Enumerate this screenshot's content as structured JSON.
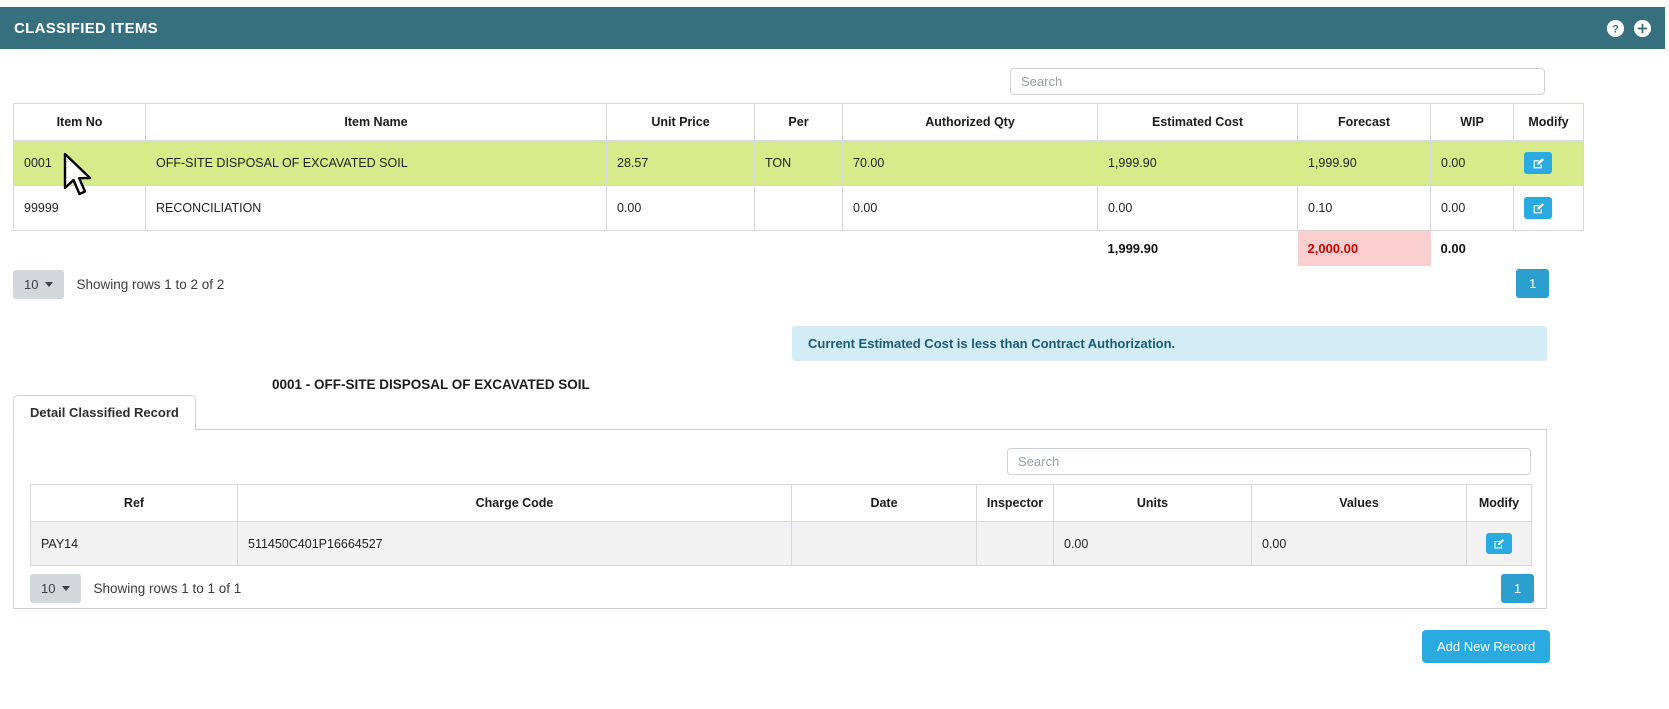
{
  "header": {
    "title": "CLASSIFIED ITEMS",
    "help_icon": "help-circle-icon",
    "add_icon": "plus-circle-icon"
  },
  "main_search": {
    "placeholder": "Search",
    "value": ""
  },
  "main_table": {
    "columns": [
      "Item No",
      "Item Name",
      "Unit Price",
      "Per",
      "Authorized Qty",
      "Estimated Cost",
      "Forecast",
      "WIP",
      "Modify"
    ],
    "rows": [
      {
        "item_no": "0001",
        "item_name": "OFF-SITE DISPOSAL OF EXCAVATED SOIL",
        "unit_price": "28.57",
        "per": "TON",
        "authorized_qty": "70.00",
        "estimated_cost": "1,999.90",
        "forecast": "1,999.90",
        "wip": "0.00",
        "modify_icon": "edit-square-icon",
        "selected": true
      },
      {
        "item_no": "99999",
        "item_name": "RECONCILIATION",
        "unit_price": "0.00",
        "per": "",
        "authorized_qty": "0.00",
        "estimated_cost": "0.00",
        "forecast": "0.10",
        "wip": "0.00",
        "modify_icon": "edit-square-icon",
        "selected": false
      }
    ],
    "totals": {
      "estimated_cost": "1,999.90",
      "forecast": "2,000.00",
      "wip": "0.00",
      "forecast_warning_color": "#d40000",
      "forecast_warning_bg": "#fbcfcf"
    }
  },
  "main_pager": {
    "page_size": "10",
    "showing_text": "Showing rows 1 to 2 of 2",
    "page_number": "1"
  },
  "alert": {
    "message": "Current Estimated Cost is less than Contract Authorization.",
    "bg_color": "#d3edf7",
    "text_color": "#1c5a73"
  },
  "detail": {
    "title": "0001 - OFF-SITE DISPOSAL OF EXCAVATED SOIL",
    "tab_label": "Detail Classified Record",
    "search": {
      "placeholder": "Search",
      "value": ""
    },
    "columns": [
      "Ref",
      "Charge Code",
      "Date",
      "Inspector",
      "Units",
      "Values",
      "Modify"
    ],
    "rows": [
      {
        "ref": "PAY14",
        "charge_code": "511450C401P16664527",
        "date": "",
        "inspector": "",
        "units": "0.00",
        "values": "0.00",
        "modify_icon": "edit-square-icon"
      }
    ],
    "pager": {
      "page_size": "10",
      "showing_text": "Showing rows 1 to 1 of 1",
      "page_number": "1"
    },
    "add_button": "Add New Record"
  },
  "theme": {
    "header_bg": "#36707f",
    "accent_blue": "#29abe2",
    "selected_row_bg": "#d7eb8a"
  }
}
